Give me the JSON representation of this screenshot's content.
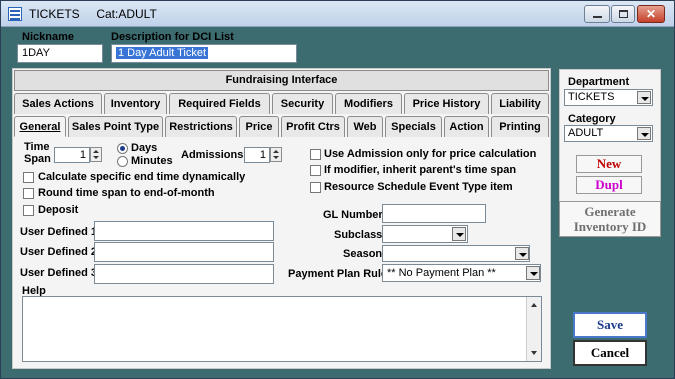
{
  "window": {
    "title": "TICKETS     Cat:ADULT"
  },
  "header": {
    "nickname_label": "Nickname",
    "nickname_value": "1DAY",
    "description_label": "Description for DCI List",
    "description_value": "1 Day Adult Ticket"
  },
  "fundraising": {
    "label": "Fundraising Interface"
  },
  "tabs_row1": [
    "Sales Actions",
    "Inventory",
    "Required Fields",
    "Security",
    "Modifiers",
    "Price History",
    "Liability"
  ],
  "tabs_row2": [
    "General",
    "Sales Point Type",
    "Restrictions",
    "Price",
    "Profit Ctrs",
    "Web",
    "Specials",
    "Action",
    "Printing"
  ],
  "active_tab": "General",
  "general": {
    "time_span_label": "Time\nSpan",
    "time_span_value": "1",
    "unit_days": "Days",
    "unit_minutes": "Minutes",
    "selected_unit": "Days",
    "admissions_label": "Admissions",
    "admissions_value": "1",
    "calc_end_time": "Calculate specific end time dynamically",
    "round_time": "Round time span to end-of-month",
    "deposit": "Deposit",
    "use_admission": "Use Admission only for price calculation",
    "inherit_time": "If modifier, inherit parent's time span",
    "resource_schedule": "Resource Schedule Event Type item",
    "user_defined_1": "User Defined 1",
    "user_defined_2": "User Defined 2",
    "user_defined_3": "User Defined 3",
    "gl_number": "GL Number",
    "subclass": "Subclass",
    "season": "Season",
    "payment_plan_rule": "Payment Plan Rule",
    "payment_plan_value": "** No Payment Plan **",
    "help": "Help"
  },
  "sidebar": {
    "department_label": "Department",
    "department_value": "TICKETS",
    "category_label": "Category",
    "category_value": "ADULT",
    "new_label": "New",
    "dupl_label": "Dupl",
    "generate_label": "Generate\nInventory ID",
    "save_label": "Save",
    "cancel_label": "Cancel"
  },
  "colors": {
    "background": "#3c6b70",
    "new": "#c00000",
    "dupl": "#cc00cc",
    "save": "#1a3a8a",
    "generate": "#707070"
  }
}
